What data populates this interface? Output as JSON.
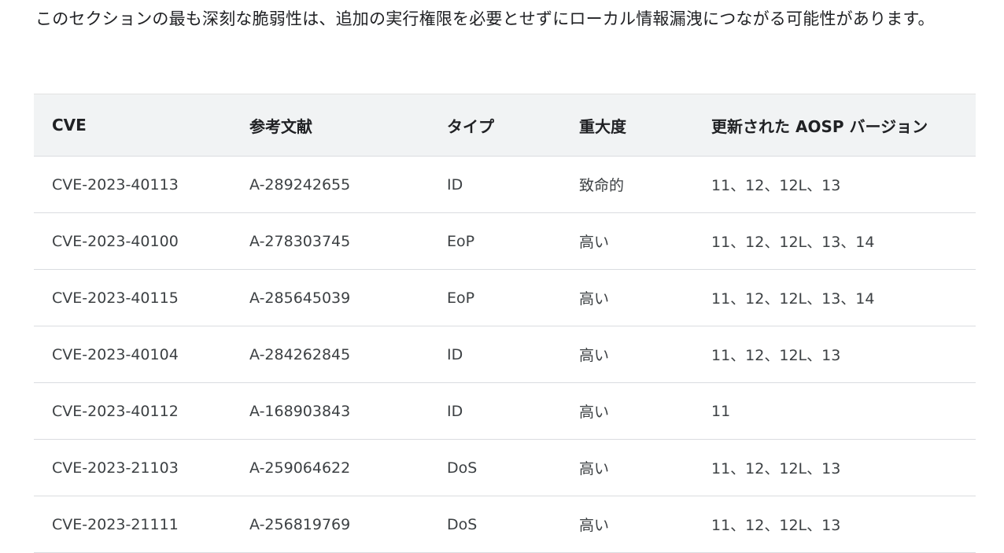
{
  "intro": {
    "text": "このセクションの最も深刻な脆弱性は、追加の実行権限を必要とせずにローカル情報漏洩につながる可能性があります。"
  },
  "table": {
    "headers": [
      "CVE",
      "参考文献",
      "タイプ",
      "重大度",
      "更新された AOSP バージョン"
    ],
    "rows": [
      [
        "CVE-2023-40113",
        "A-289242655",
        "ID",
        "致命的",
        "11、12、12L、13"
      ],
      [
        "CVE-2023-40100",
        "A-278303745",
        "EoP",
        "高い",
        "11、12、12L、13、14"
      ],
      [
        "CVE-2023-40115",
        "A-285645039",
        "EoP",
        "高い",
        "11、12、12L、13、14"
      ],
      [
        "CVE-2023-40104",
        "A-284262845",
        "ID",
        "高い",
        "11、12、12L、13"
      ],
      [
        "CVE-2023-40112",
        "A-168903843",
        "ID",
        "高い",
        "11"
      ],
      [
        "CVE-2023-21103",
        "A-259064622",
        "DoS",
        "高い",
        "11、12、12L、13"
      ],
      [
        "CVE-2023-21111",
        "A-256819769",
        "DoS",
        "高い",
        "11、12、12L、13"
      ]
    ]
  }
}
